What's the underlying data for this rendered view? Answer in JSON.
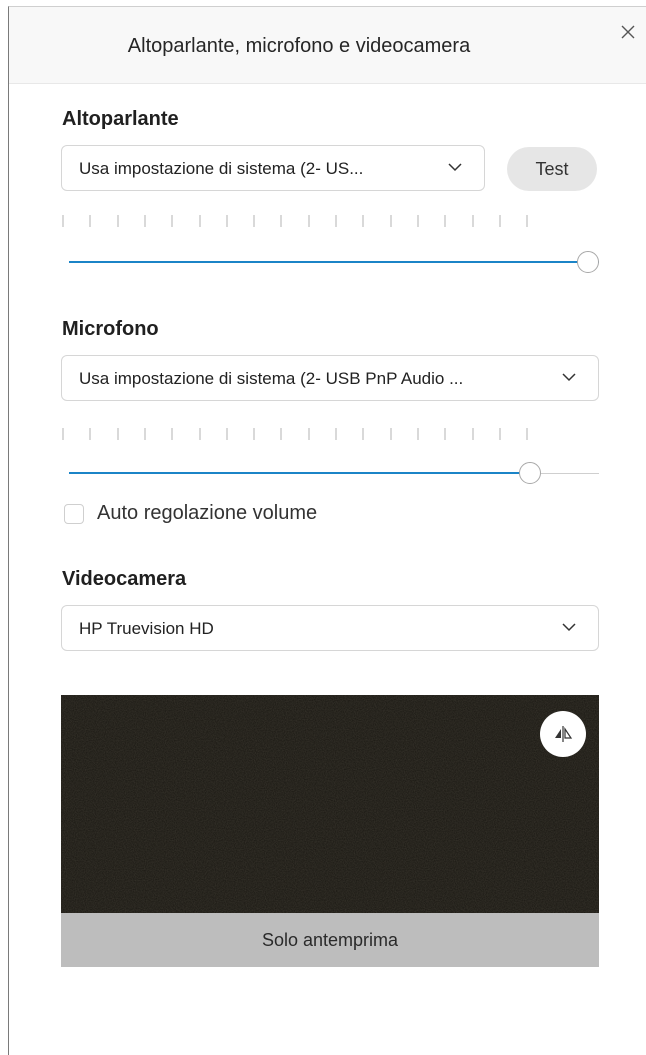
{
  "dialog": {
    "title": "Altoparlante, microfono e videocamera",
    "close_icon": "close-icon"
  },
  "speaker": {
    "heading": "Altoparlante",
    "device": "Usa impostazione di sistema (2- US...",
    "test_label": "Test",
    "volume_level": 1.0,
    "meter_level": 0
  },
  "microphone": {
    "heading": "Microfono",
    "device": "Usa impostazione di sistema (2- USB PnP Audio ...",
    "volume_level": 0.87,
    "meter_level": 0,
    "auto_adjust_label": "Auto regolazione volume",
    "auto_adjust_checked": false
  },
  "camera": {
    "heading": "Videocamera",
    "device": "HP Truevision HD",
    "preview_caption": "Solo antemprima",
    "mirror_icon": "mirror-flip-icon"
  },
  "colors": {
    "accent": "#1b84c7",
    "preview_bg": "#161410",
    "caption_bar": "#bdbdbd"
  }
}
